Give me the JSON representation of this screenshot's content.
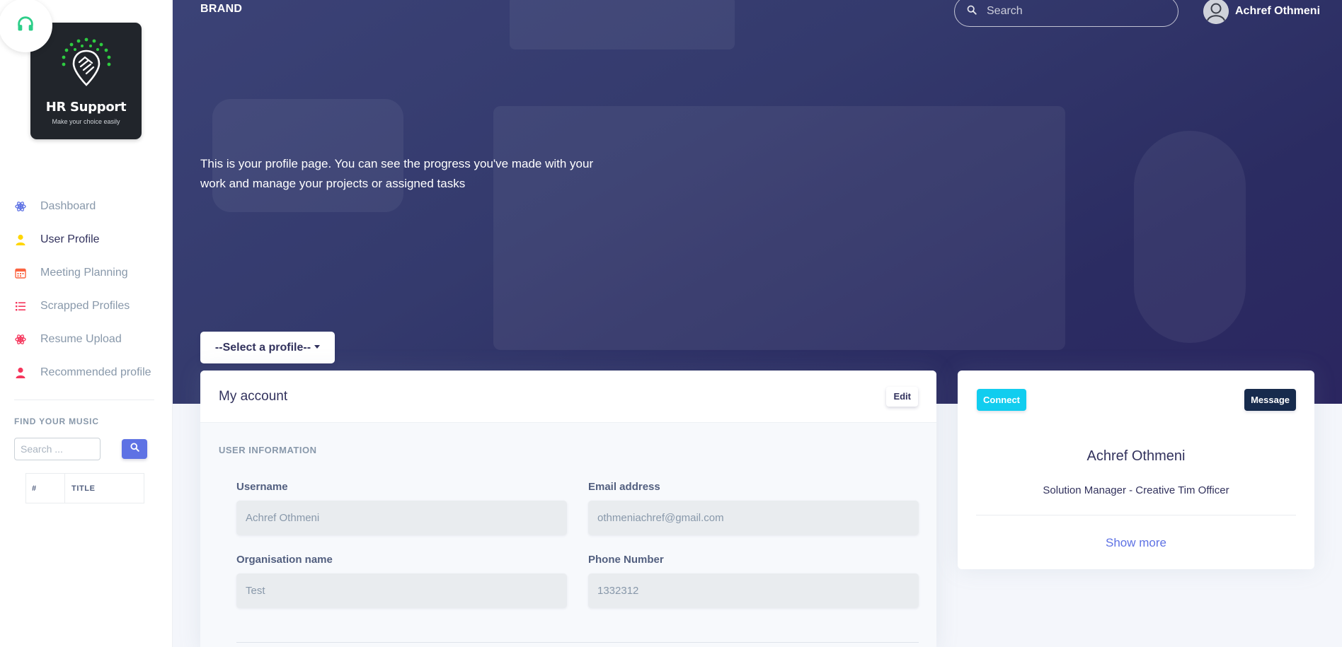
{
  "sidebar": {
    "logo": {
      "title": "HR Support",
      "tagline": "Make your choice easily"
    },
    "items": [
      {
        "label": "Dashboard",
        "icon": "atom-icon",
        "color": "#5e72e4",
        "active": false
      },
      {
        "label": "User Profile",
        "icon": "user-icon",
        "color": "#ffd600",
        "active": true
      },
      {
        "label": "Meeting Planning",
        "icon": "calendar-icon",
        "color": "#fb6340",
        "active": false
      },
      {
        "label": "Scrapped Profiles",
        "icon": "list-icon",
        "color": "#f5365c",
        "active": false
      },
      {
        "label": "Resume Upload",
        "icon": "atom-icon",
        "color": "#f5365c",
        "active": false
      },
      {
        "label": "Recommended profile",
        "icon": "user-icon",
        "color": "#f5365c",
        "active": false
      }
    ],
    "music": {
      "heading": "FIND YOUR MUSIC",
      "search_placeholder": "Search ...",
      "columns": [
        "#",
        "TITLE"
      ]
    }
  },
  "header": {
    "brand": "BRAND",
    "search_placeholder": "Search",
    "user_name": "Achref Othmeni"
  },
  "hero": {
    "text": "This is your profile page. You can see the progress you've made with your work and manage your projects or assigned tasks"
  },
  "select_profile": {
    "label": "--Select a profile--"
  },
  "account": {
    "title": "My account",
    "edit_label": "Edit",
    "section": "USER INFORMATION",
    "fields": {
      "username": {
        "label": "Username",
        "value": "Achref Othmeni"
      },
      "email": {
        "label": "Email address",
        "value": "othmeniachref@gmail.com"
      },
      "organisation": {
        "label": "Organisation name",
        "value": "Test"
      },
      "phone": {
        "label": "Phone Number",
        "value": "1332312"
      }
    }
  },
  "profile_card": {
    "connect_label": "Connect",
    "message_label": "Message",
    "name": "Achref Othmeni",
    "role": "Solution Manager - Creative Tim Officer",
    "show_more": "Show more"
  },
  "colors": {
    "primary": "#5e72e4",
    "info": "#11cdef",
    "default": "#172b4d",
    "logo_green": "#2ecc40"
  }
}
